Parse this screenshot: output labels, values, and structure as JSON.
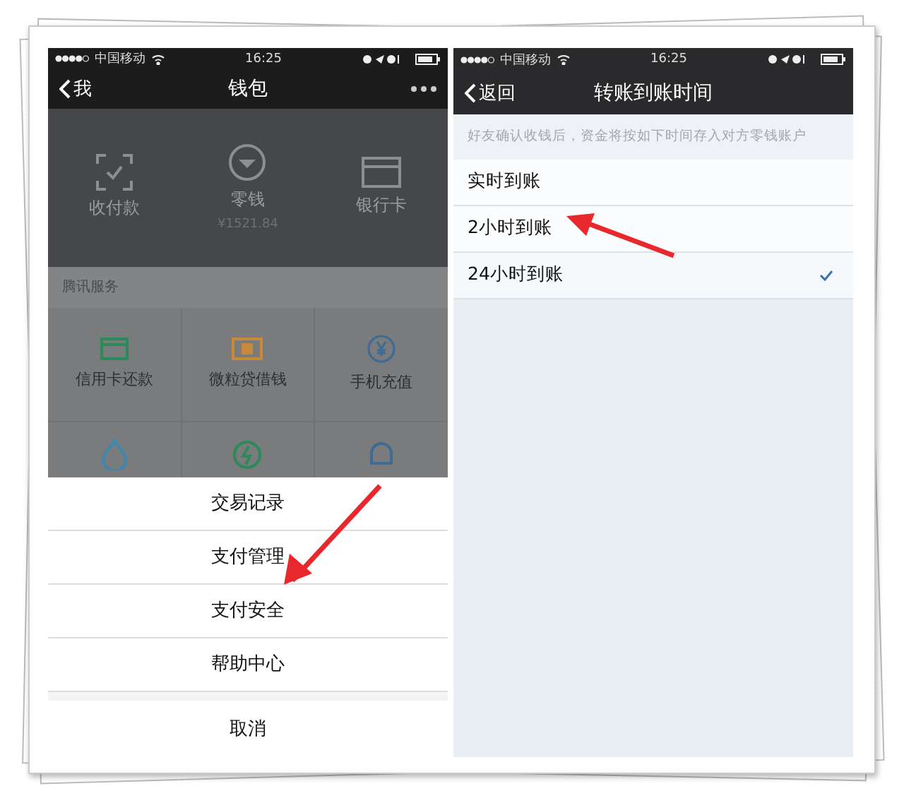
{
  "left_phone": {
    "status_bar": {
      "carrier": "中国移动",
      "time": "16:25"
    },
    "nav_bar": {
      "back": "我",
      "title": "钱包"
    },
    "wallet_items": [
      {
        "label": "收付款",
        "kind": "scan"
      },
      {
        "label": "零钱",
        "sub": "¥1521.84",
        "kind": "coin"
      },
      {
        "label": "银行卡",
        "kind": "card"
      }
    ],
    "section_label": "腾讯服务",
    "services": [
      {
        "label": "信用卡还款",
        "kind": "credit",
        "color": "#2a8a5a"
      },
      {
        "label": "微粒贷借钱",
        "kind": "loan",
        "color": "#c7893a"
      },
      {
        "label": "手机充值",
        "kind": "yen",
        "color": "#3d6b94"
      },
      {
        "kind": "drop",
        "color": "#3d88b0"
      },
      {
        "kind": "bolt",
        "color": "#2a8a5a"
      },
      {
        "kind": "bell",
        "color": "#3d6b94"
      }
    ],
    "action_sheet": {
      "items": [
        "交易记录",
        "支付管理",
        "支付安全",
        "帮助中心"
      ],
      "cancel": "取消"
    }
  },
  "right_phone": {
    "status_bar": {
      "carrier": "中国移动",
      "time": "16:25"
    },
    "nav_bar": {
      "back": "返回",
      "title": "转账到账时间"
    },
    "hint": "好友确认收钱后，资金将按如下时间存入对方零钱账户",
    "options": [
      {
        "label": "实时到账",
        "selected": false
      },
      {
        "label": "2小时到账",
        "selected": false
      },
      {
        "label": "24小时到账",
        "selected": true
      }
    ]
  }
}
